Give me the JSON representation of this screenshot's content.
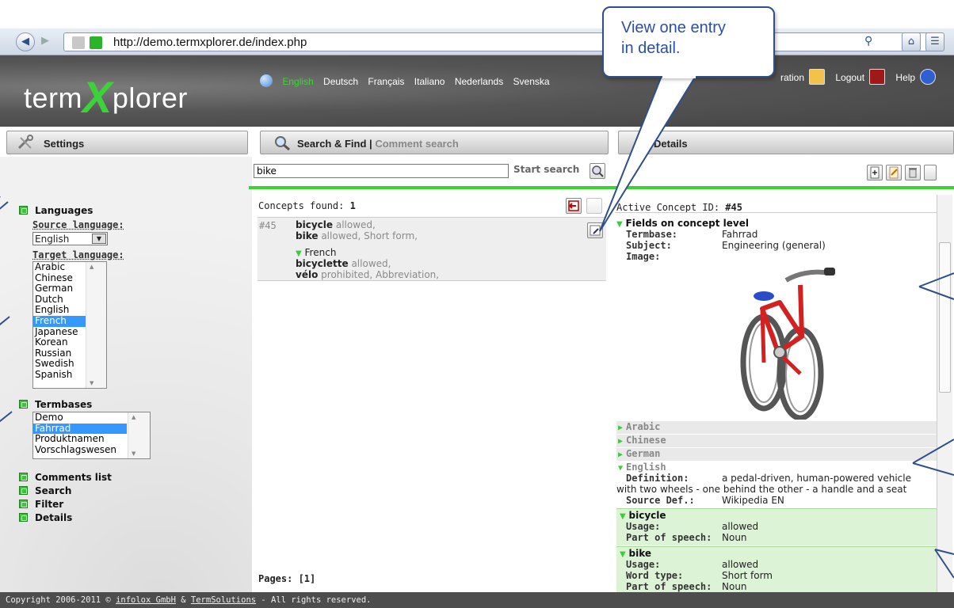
{
  "browser": {
    "url": "http://demo.termxplorer.de/index.php"
  },
  "header": {
    "logo": {
      "left": "term",
      "x": "X",
      "right": "plorer"
    },
    "languages": [
      "English",
      "Deutsch",
      "Français",
      "Italiano",
      "Nederlands",
      "Svenska"
    ],
    "selected_language": "English",
    "user_menu": {
      "registration": "ration",
      "logout": "Logout",
      "help": "Help"
    }
  },
  "panels": {
    "settings": "Settings",
    "search_find": "Search & Find",
    "separator": "|",
    "comment_search": "Comment search",
    "details": "Details"
  },
  "settings": {
    "languages_heading": "Languages",
    "source_language_label": "Source language:",
    "source_language_value": "English",
    "target_language_label": "Target language:",
    "target_languages": [
      "Arabic",
      "Chinese",
      "German",
      "Dutch",
      "English",
      "French",
      "Japanese",
      "Korean",
      "Russian",
      "Swedish",
      "Spanish"
    ],
    "target_selected": "French",
    "termbases_heading": "Termbases",
    "termbases": [
      "Demo",
      "Fahrrad",
      "Produktnamen",
      "Vorschlagswesen"
    ],
    "termbase_selected": "Fahrrad",
    "links": [
      "Comments list",
      "Search",
      "Filter",
      "Details"
    ]
  },
  "search": {
    "query": "bike",
    "start_label": "Start search",
    "concepts_found_label": "Concepts found:",
    "concepts_found_count": "1",
    "result": {
      "id": "#45",
      "term1": "bicycle",
      "term1_meta": "allowed,",
      "term2": "bike",
      "term2_meta": "allowed, Short form,",
      "target_lang": "French",
      "term3": "bicyclette",
      "term3_meta": "allowed,",
      "term4": "vélo",
      "term4_meta": "prohibited, Abbreviation,"
    },
    "pages_label": "Pages: [1]"
  },
  "details": {
    "active_label": "Active Concept ID:",
    "active_id": "#45",
    "concept_fields_heading": "Fields on concept level",
    "termbase_label": "Termbase:",
    "termbase_value": "Fahrrad",
    "subject_label": "Subject:",
    "subject_value": "Engineering (general)",
    "image_label": "Image:",
    "collapsed_languages": [
      "Arabic",
      "Chinese",
      "German"
    ],
    "english_heading": "English",
    "definition_label": "Definition:",
    "definition_line1": "a pedal-driven, human-powered vehicle",
    "definition_line2": "with two wheels - one behind the other - a handle and a seat",
    "source_def_label": "Source Def.:",
    "source_def_value": "Wikipedia EN",
    "terms": [
      {
        "name": "bicycle",
        "usage_label": "Usage:",
        "usage": "allowed",
        "pos_label": "Part of speech:",
        "pos": "Noun"
      },
      {
        "name": "bike",
        "usage_label": "Usage:",
        "usage": "allowed",
        "word_type_label": "Word type:",
        "word_type": "Short form",
        "pos_label": "Part of speech:",
        "pos": "Noun"
      }
    ]
  },
  "footer": {
    "prefix": "Copyright 2006-2011 © ",
    "link1": "infolox GmbH",
    "mid": " & ",
    "link2": "TermSolutions",
    "suffix": " - All rights reserved."
  },
  "callout": {
    "line1": "View one entry",
    "line2": "in detail."
  },
  "colors": {
    "accent_green": "#3ad42e",
    "selection_blue": "#3399ff",
    "callout_blue": "#2a4fa8",
    "header_gray": "#555555"
  }
}
